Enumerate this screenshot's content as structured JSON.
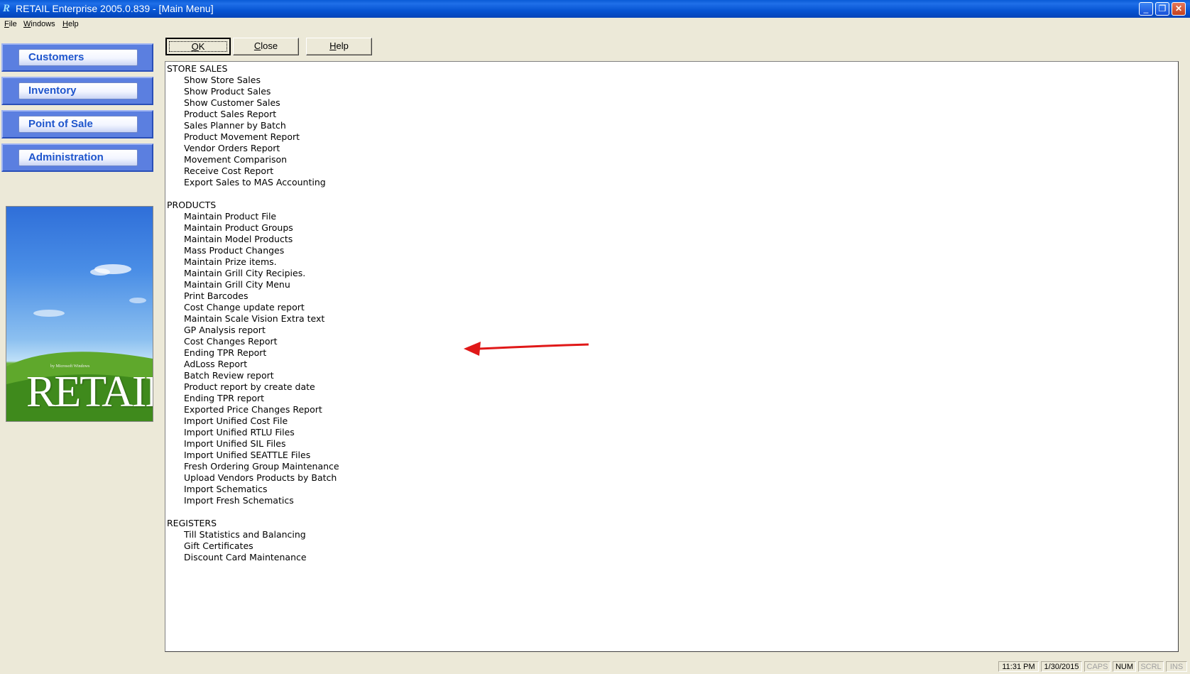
{
  "window": {
    "title": "RETAIL Enterprise 2005.0.839 - [Main Menu]",
    "app_icon": "R",
    "controls": {
      "minimize": "_",
      "restore": "❐",
      "close": "✕"
    }
  },
  "menubar": [
    "File",
    "Windows",
    "Help"
  ],
  "nav": [
    {
      "label": "Customers"
    },
    {
      "label": "Inventory"
    },
    {
      "label": "Point of Sale"
    },
    {
      "label": "Administration"
    }
  ],
  "splash": {
    "small_text": "by Microsoft Windows",
    "logo": "RETAIL"
  },
  "actions": {
    "ok": "OK",
    "close": "Close",
    "help": "Help"
  },
  "menu_sections": [
    {
      "header": "STORE SALES",
      "items": [
        "Show Store Sales",
        "Show Product Sales",
        "Show Customer Sales",
        "Product Sales Report",
        "Sales Planner by Batch",
        "Product Movement Report",
        "Vendor Orders Report",
        "Movement Comparison",
        "Receive Cost Report",
        "Export Sales to MAS Accounting"
      ]
    },
    {
      "header": "PRODUCTS",
      "items": [
        "Maintain Product File",
        "Maintain Product Groups",
        "Maintain Model Products",
        "Mass Product Changes",
        "Maintain Prize items.",
        "Maintain Grill City Recipies.",
        "Maintain Grill City Menu",
        "Print Barcodes",
        "Cost Change update report",
        "Maintain Scale Vision Extra text",
        "GP Analysis report",
        "Cost Changes Report",
        "Ending TPR Report",
        "AdLoss Report",
        "Batch Review report",
        "Product report by create date",
        "Ending TPR report",
        "Exported Price Changes Report",
        "Import Unified Cost File",
        "Import Unified RTLU Files",
        "Import Unified SIL Files",
        "Import Unified SEATTLE Files",
        "Fresh Ordering Group Maintenance",
        "Upload Vendors Products by Batch",
        "Import Schematics",
        "Import Fresh Schematics"
      ]
    },
    {
      "header": "REGISTERS",
      "items": [
        "Till Statistics and Balancing",
        "Gift Certificates",
        "Discount Card Maintenance"
      ]
    }
  ],
  "annotation": {
    "points_to": "Maintain Grill City Menu",
    "color": "#e01818"
  },
  "statusbar": {
    "time": "11:31 PM",
    "date": "1/30/2015",
    "caps": "CAPS",
    "num": "NUM",
    "scrl": "SCRL",
    "ins": "INS"
  }
}
